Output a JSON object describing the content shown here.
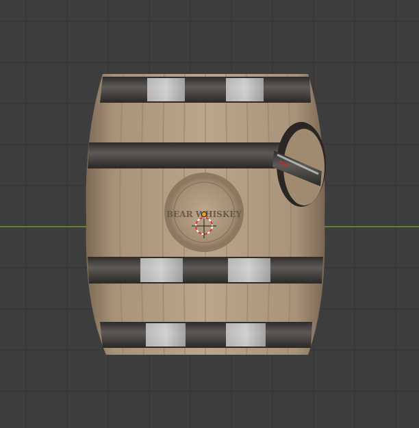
{
  "viewport": {
    "background_color": "#3d3d3d",
    "grid_color": "#333333",
    "x_axis_color": "#6a9a2a"
  },
  "barrel": {
    "label_text": "BEAR WHISKEY",
    "wood_color": "#b09a80",
    "wood_dark": "#8f7a62",
    "band_color": "#5a5654",
    "band_highlight": "#c8c8c8"
  },
  "gizmo": {
    "origin_icon": "3d-cursor-icon"
  }
}
